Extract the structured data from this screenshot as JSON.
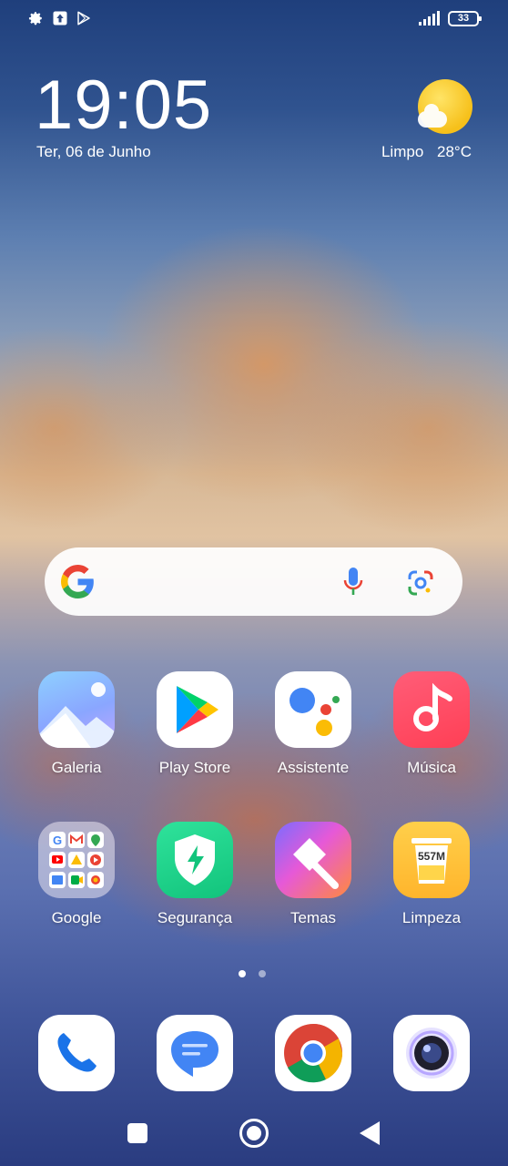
{
  "status_bar": {
    "icons": [
      "gear-icon",
      "upload-icon",
      "play-store-icon"
    ],
    "signal": "signal-icon",
    "battery": "33"
  },
  "clock": {
    "time": "19:05",
    "date": "Ter, 06 de Junho"
  },
  "weather": {
    "icon": "sun-cloud-icon",
    "condition": "Limpo",
    "temperature": "28°C"
  },
  "search": {
    "logo": "google-logo-icon",
    "mic": "microphone-icon",
    "lens": "google-lens-icon"
  },
  "apps": [
    {
      "label": "Galeria"
    },
    {
      "label": "Play Store"
    },
    {
      "label": "Assistente"
    },
    {
      "label": "Música"
    },
    {
      "label": "Google"
    },
    {
      "label": "Segurança"
    },
    {
      "label": "Temas"
    },
    {
      "label": "Limpeza",
      "badge": "557M"
    }
  ],
  "dock": [
    "phone-icon",
    "messages-icon",
    "chrome-icon",
    "camera-icon"
  ],
  "page_indicator": {
    "pages": 2,
    "current": 1
  },
  "nav": [
    "recent-apps-button",
    "home-button",
    "back-button"
  ]
}
